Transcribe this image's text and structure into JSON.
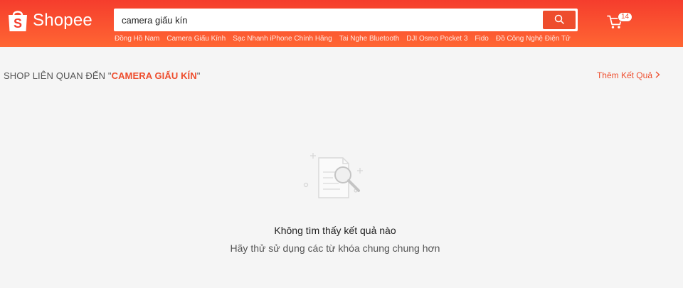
{
  "brand": {
    "name": "Shopee",
    "logo_icon": "shopping-bag-icon",
    "header_color_top": "#f53d2d",
    "header_color_bottom": "#ff6633",
    "accent": "#ee4d2d"
  },
  "search": {
    "value": "camera giấu kín",
    "button_icon": "search-icon"
  },
  "suggestions": [
    "Đồng Hồ Nam",
    "Camera Giấu Kính",
    "Sạc Nhanh iPhone Chính Hãng",
    "Tai Nghe Bluetooth",
    "DJI Osmo Pocket 3",
    "Fido",
    "Đồ Công Nghệ Điện Tử"
  ],
  "cart": {
    "icon": "cart-icon",
    "count": "14"
  },
  "section": {
    "prefix": "SHOP LIÊN QUAN ĐẾN \"",
    "keyword": "CAMERA GIẤU KÍN",
    "suffix": "\"",
    "more_label": "Thêm Kết Quả"
  },
  "empty_state": {
    "icon": "document-search-icon",
    "title": "Không tìm thấy kết quả nào",
    "subtitle": "Hãy thử sử dụng các từ khóa chung chung hơn"
  }
}
